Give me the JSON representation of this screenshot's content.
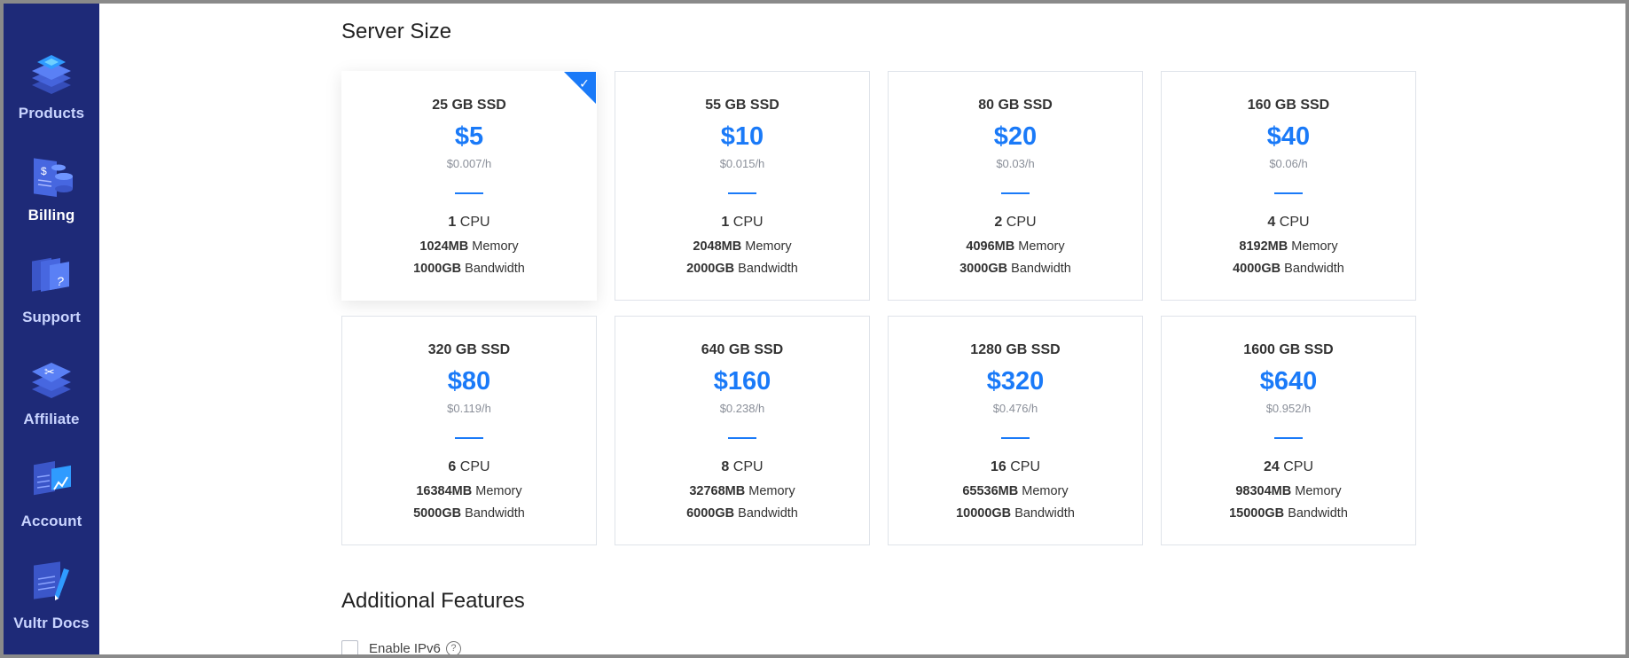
{
  "sidebar": {
    "items": [
      {
        "label": "Products",
        "icon": "layers-icon"
      },
      {
        "label": "Billing",
        "icon": "billing-icon"
      },
      {
        "label": "Support",
        "icon": "support-icon"
      },
      {
        "label": "Affiliate",
        "icon": "affiliate-icon"
      },
      {
        "label": "Account",
        "icon": "account-icon"
      },
      {
        "label": "Vultr Docs",
        "icon": "docs-icon"
      }
    ]
  },
  "server_size": {
    "title": "Server Size",
    "cards": [
      {
        "storage": "25 GB SSD",
        "price": "$5",
        "hourly": "$0.007/h",
        "cpu": "1",
        "cpu_label": "CPU",
        "memory": "1024MB",
        "memory_label": "Memory",
        "bandwidth": "1000GB",
        "bandwidth_label": "Bandwidth",
        "selected": true
      },
      {
        "storage": "55 GB SSD",
        "price": "$10",
        "hourly": "$0.015/h",
        "cpu": "1",
        "cpu_label": "CPU",
        "memory": "2048MB",
        "memory_label": "Memory",
        "bandwidth": "2000GB",
        "bandwidth_label": "Bandwidth",
        "selected": false
      },
      {
        "storage": "80 GB SSD",
        "price": "$20",
        "hourly": "$0.03/h",
        "cpu": "2",
        "cpu_label": "CPU",
        "memory": "4096MB",
        "memory_label": "Memory",
        "bandwidth": "3000GB",
        "bandwidth_label": "Bandwidth",
        "selected": false
      },
      {
        "storage": "160 GB SSD",
        "price": "$40",
        "hourly": "$0.06/h",
        "cpu": "4",
        "cpu_label": "CPU",
        "memory": "8192MB",
        "memory_label": "Memory",
        "bandwidth": "4000GB",
        "bandwidth_label": "Bandwidth",
        "selected": false
      },
      {
        "storage": "320 GB SSD",
        "price": "$80",
        "hourly": "$0.119/h",
        "cpu": "6",
        "cpu_label": "CPU",
        "memory": "16384MB",
        "memory_label": "Memory",
        "bandwidth": "5000GB",
        "bandwidth_label": "Bandwidth",
        "selected": false
      },
      {
        "storage": "640 GB SSD",
        "price": "$160",
        "hourly": "$0.238/h",
        "cpu": "8",
        "cpu_label": "CPU",
        "memory": "32768MB",
        "memory_label": "Memory",
        "bandwidth": "6000GB",
        "bandwidth_label": "Bandwidth",
        "selected": false
      },
      {
        "storage": "1280 GB SSD",
        "price": "$320",
        "hourly": "$0.476/h",
        "cpu": "16",
        "cpu_label": "CPU",
        "memory": "65536MB",
        "memory_label": "Memory",
        "bandwidth": "10000GB",
        "bandwidth_label": "Bandwidth",
        "selected": false
      },
      {
        "storage": "1600 GB SSD",
        "price": "$640",
        "hourly": "$0.952/h",
        "cpu": "24",
        "cpu_label": "CPU",
        "memory": "98304MB",
        "memory_label": "Memory",
        "bandwidth": "15000GB",
        "bandwidth_label": "Bandwidth",
        "selected": false
      }
    ]
  },
  "additional_features": {
    "title": "Additional Features",
    "items": [
      {
        "label": "Enable IPv6",
        "checked": false,
        "help_icon": "question-circle-icon"
      }
    ]
  },
  "colors": {
    "sidebar_bg": "#1e2a78",
    "accent": "#1a7af8"
  }
}
